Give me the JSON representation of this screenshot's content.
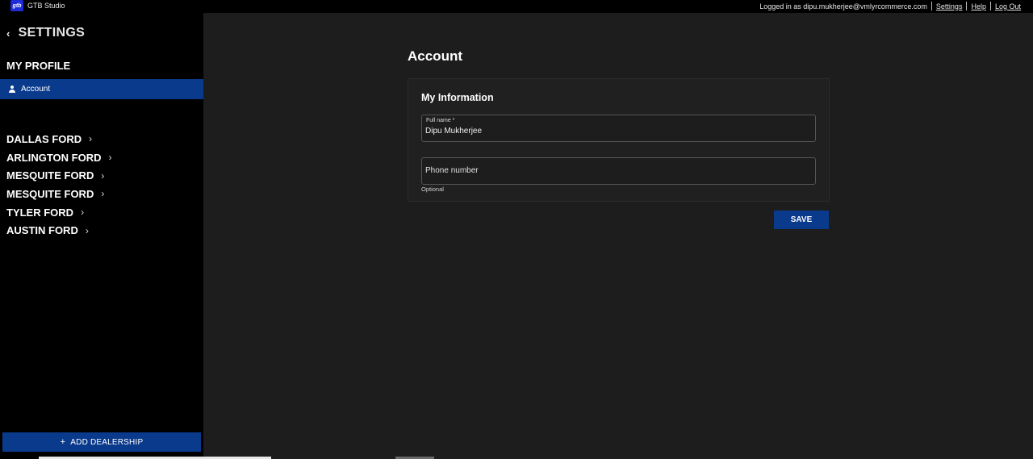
{
  "app": {
    "logo_text": "gtb",
    "title": "GTB Studio"
  },
  "topbar": {
    "logged_in_text": "Logged in as dipu.mukherjee@vmlyrcommerce.com",
    "links": [
      "Settings",
      "Help",
      "Log Out"
    ]
  },
  "sidebar": {
    "header": "SETTINGS",
    "section_title": "MY PROFILE",
    "active_item": "Account",
    "dealerships": [
      "DALLAS FORD",
      "ARLINGTON FORD",
      "MESQUITE FORD",
      "MESQUITE FORD",
      "TYLER FORD",
      "AUSTIN FORD"
    ],
    "add_button": "ADD DEALERSHIP"
  },
  "main": {
    "title": "Account",
    "card_title": "My Information",
    "full_name_label": "Full name *",
    "full_name_value": "Dipu Mukherjee",
    "phone_placeholder": "Phone number",
    "phone_hint": "Optional",
    "save_label": "SAVE"
  },
  "colors": {
    "accent": "#0a3a8c",
    "sidebar_bg": "#000000",
    "main_bg": "#1d1d1d"
  }
}
